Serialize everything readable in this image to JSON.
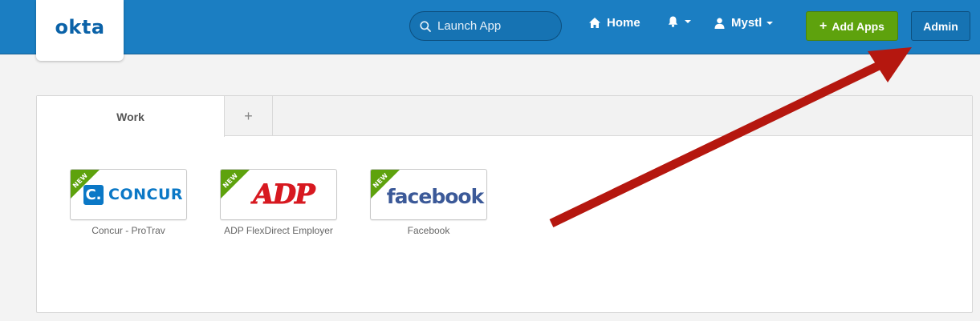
{
  "header": {
    "logo": "okta",
    "search": {
      "placeholder": "Launch App"
    },
    "nav": {
      "home": "Home",
      "user": "Mystl"
    },
    "add_apps": "Add Apps",
    "admin": "Admin"
  },
  "tabs": [
    {
      "label": "Work"
    },
    {
      "label": "+"
    }
  ],
  "apps": [
    {
      "name": "Concur - ProTrav",
      "logo_mark": "C.",
      "logo_text": "CONCUR",
      "badge": "NEW"
    },
    {
      "name": "ADP FlexDirect Employer",
      "logo_text": "ADP",
      "badge": "NEW"
    },
    {
      "name": "Facebook",
      "logo_text": "facebook",
      "badge": "NEW"
    }
  ],
  "colors": {
    "header_bg": "#1b7ec2",
    "add_button": "#5ea20d",
    "arrow": "#b5170f"
  },
  "icons": [
    "search-icon",
    "home-icon",
    "bell-icon",
    "user-icon",
    "chevron-down-icon"
  ]
}
